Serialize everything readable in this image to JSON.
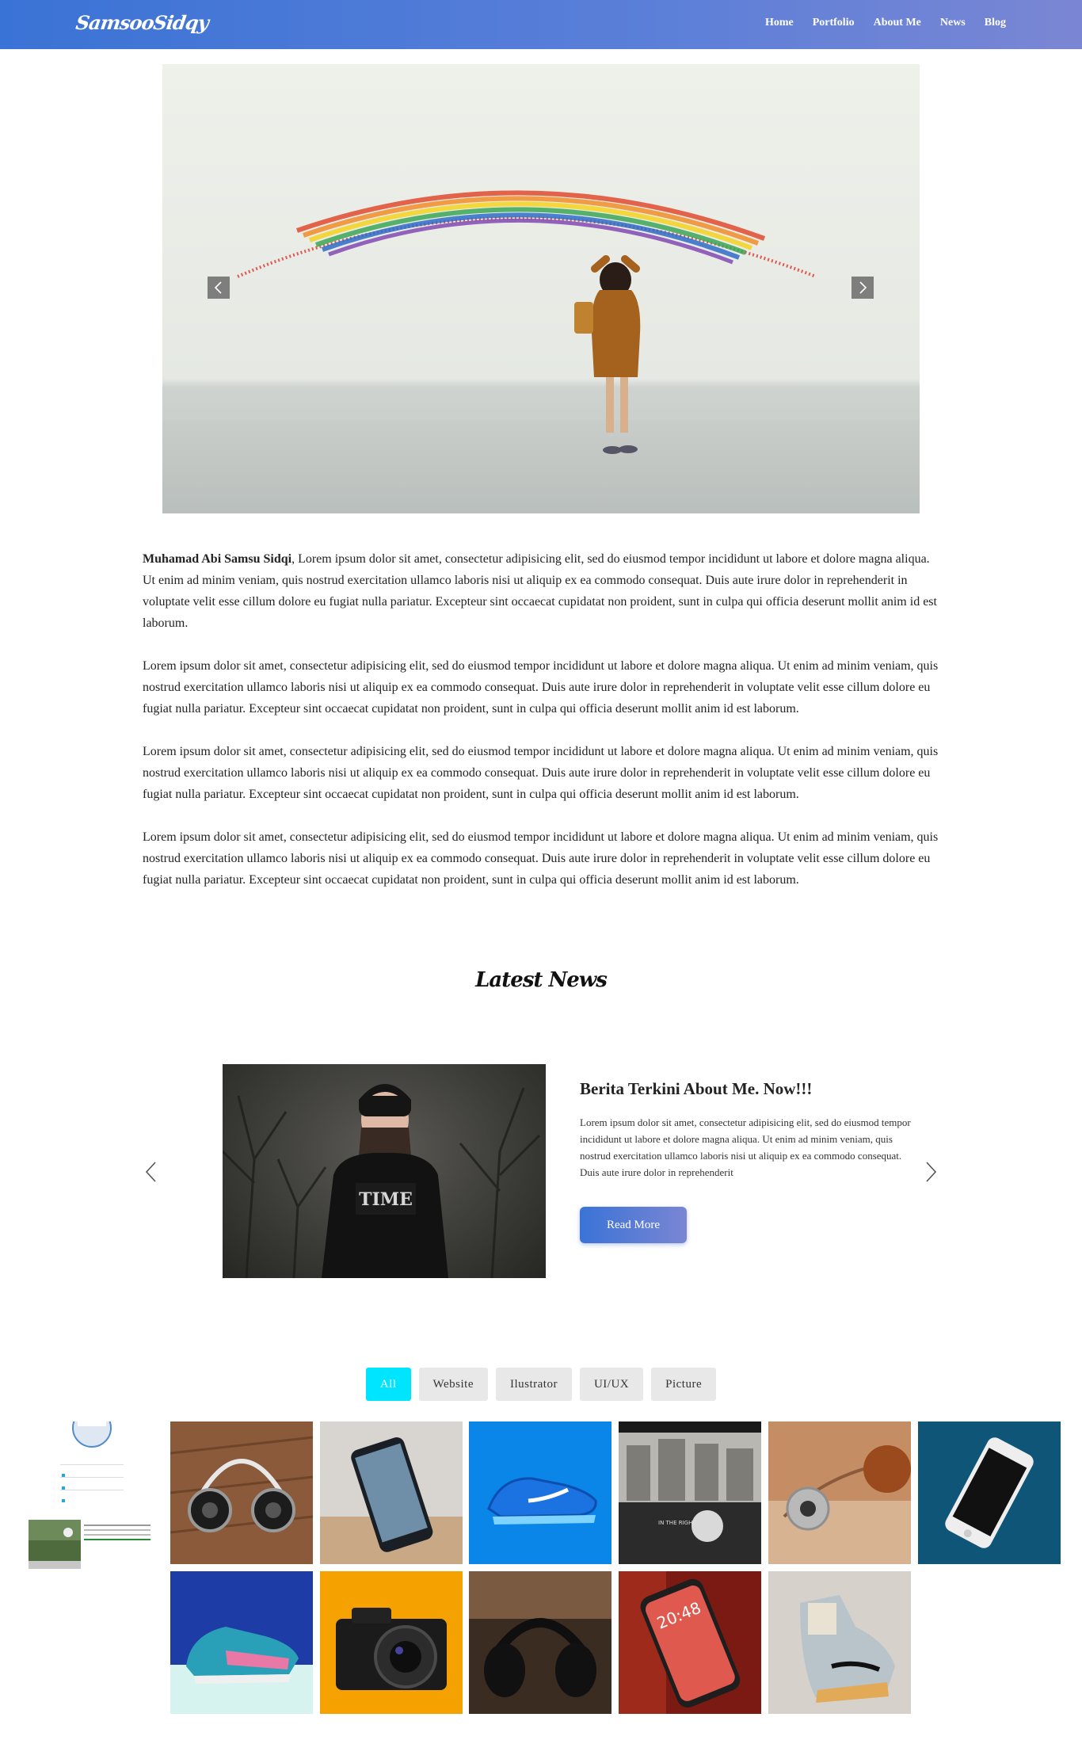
{
  "nav": {
    "brand": "SamsooSidqy",
    "links": [
      "Home",
      "Portfolio",
      "About Me",
      "News",
      "Blog"
    ]
  },
  "about": {
    "name": "Muhamad Abi Samsu Sidqi",
    "intro_rest": ", Lorem ipsum dolor sit amet, consectetur adipisicing elit, sed do eiusmod tempor incididunt ut labore et dolore magna aliqua. Ut enim ad minim veniam, quis nostrud exercitation ullamco laboris nisi ut aliquip ex ea commodo consequat. Duis aute irure dolor in reprehenderit in voluptate velit esse cillum dolore eu fugiat nulla pariatur. Excepteur sint occaecat cupidatat non proident, sunt in culpa qui officia deserunt mollit anim id est laborum.",
    "paragraphs": [
      "Lorem ipsum dolor sit amet, consectetur adipisicing elit, sed do eiusmod tempor incididunt ut labore et dolore magna aliqua. Ut enim ad minim veniam, quis nostrud exercitation ullamco laboris nisi ut aliquip ex ea commodo consequat. Duis aute irure dolor in reprehenderit in voluptate velit esse cillum dolore eu fugiat nulla pariatur. Excepteur sint occaecat cupidatat non proident, sunt in culpa qui officia deserunt mollit anim id est laborum.",
      "Lorem ipsum dolor sit amet, consectetur adipisicing elit, sed do eiusmod tempor incididunt ut labore et dolore magna aliqua. Ut enim ad minim veniam, quis nostrud exercitation ullamco laboris nisi ut aliquip ex ea commodo consequat. Duis aute irure dolor in reprehenderit in voluptate velit esse cillum dolore eu fugiat nulla pariatur. Excepteur sint occaecat cupidatat non proident, sunt in culpa qui officia deserunt mollit anim id est laborum.",
      "Lorem ipsum dolor sit amet, consectetur adipisicing elit, sed do eiusmod tempor incididunt ut labore et dolore magna aliqua. Ut enim ad minim veniam, quis nostrud exercitation ullamco laboris nisi ut aliquip ex ea commodo consequat. Duis aute irure dolor in reprehenderit in voluptate velit esse cillum dolore eu fugiat nulla pariatur. Excepteur sint occaecat cupidatat non proident, sunt in culpa qui officia deserunt mollit anim id est laborum."
    ]
  },
  "news": {
    "section_title": "Latest News",
    "title": "Berita Terkini About Me. Now!!!",
    "text": "Lorem ipsum dolor sit amet, consectetur adipisicing elit, sed do eiusmod tempor incididunt ut labore et dolore magna aliqua. Ut enim ad minim veniam, quis nostrud exercitation ullamco laboris nisi ut aliquip ex ea commodo consequat. Duis aute irure dolor in reprehenderit",
    "button": "Read More"
  },
  "filters": {
    "items": [
      "All",
      "Website",
      "Ilustrator",
      "UI/UX",
      "Picture"
    ],
    "active": "All"
  },
  "theme": {
    "nav_gradient_start": "#3a73d6",
    "nav_gradient_end": "#7a86d4",
    "filter_active": "#00e5ff"
  },
  "gallery": {
    "items": [
      "headphones-icon",
      "smartphone-icon",
      "sneaker-icon",
      "street-photo-icon",
      "earphones-icon",
      "iphone-icon",
      "sneaker-icon",
      "camera-icon",
      "headphones-icon",
      "iphone-icon",
      "sneaker-icon"
    ]
  }
}
